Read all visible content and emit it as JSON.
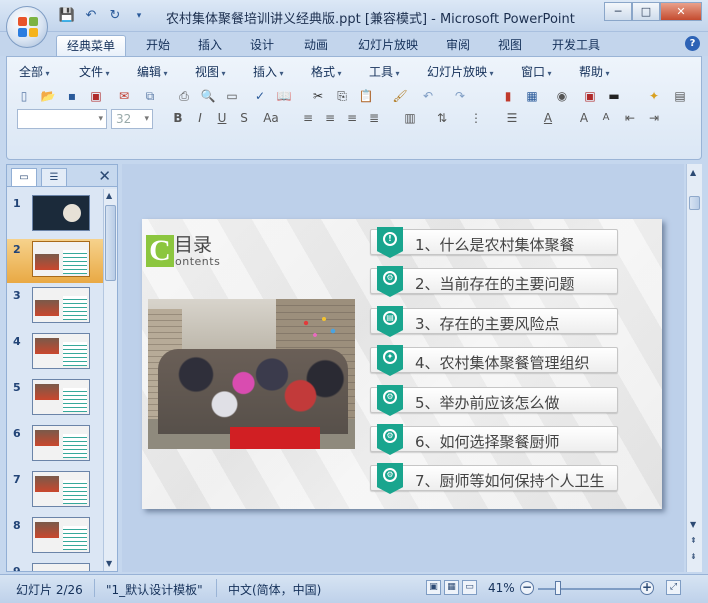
{
  "window": {
    "title": "农村集体聚餐培训讲义经典版.ppt [兼容模式] - Microsoft PowerPoint",
    "controls": [
      "─",
      "□",
      "✕"
    ]
  },
  "ribbon_tabs": [
    "经典菜单",
    "开始",
    "插入",
    "设计",
    "动画",
    "幻灯片放映",
    "审阅",
    "视图",
    "开发工具"
  ],
  "active_tab": "经典菜单",
  "menus": [
    "全部",
    "文件",
    "编辑",
    "视图",
    "插入",
    "格式",
    "工具",
    "幻灯片放映",
    "窗口",
    "帮助"
  ],
  "format_bar": {
    "font_name": "",
    "font_size": "32"
  },
  "left_panel": {
    "tab_slides_icon": "▭",
    "tab_outline_icon": "☰",
    "close": "✕",
    "slides": [
      "1",
      "2",
      "3",
      "4",
      "5",
      "6",
      "7",
      "8",
      "9"
    ],
    "selected_slide": "2"
  },
  "slide": {
    "toc_letter": "C",
    "toc_title": "目录",
    "toc_subtitle": "ontents",
    "items": [
      {
        "text": "1、什么是农村集体聚餐",
        "icon": "!"
      },
      {
        "text": "2、当前存在的主要问题",
        "icon": "⚙"
      },
      {
        "text": "3、存在的主要风险点",
        "icon": "▤"
      },
      {
        "text": "4、农村集体聚餐管理组织",
        "icon": "✦"
      },
      {
        "text": "5、举办前应该怎么做",
        "icon": "⚙"
      },
      {
        "text": "6、如何选择聚餐厨师",
        "icon": "⚙"
      },
      {
        "text": "7、厨师等如何保持个人卫生",
        "icon": "⚙"
      }
    ],
    "accent_color": "#19a58e",
    "c_color": "#8cc63f"
  },
  "status": {
    "slide_counter": "幻灯片 2/26",
    "template": "\"1_默认设计模板\"",
    "language": "中文(简体，中国)",
    "zoom": "41%"
  }
}
